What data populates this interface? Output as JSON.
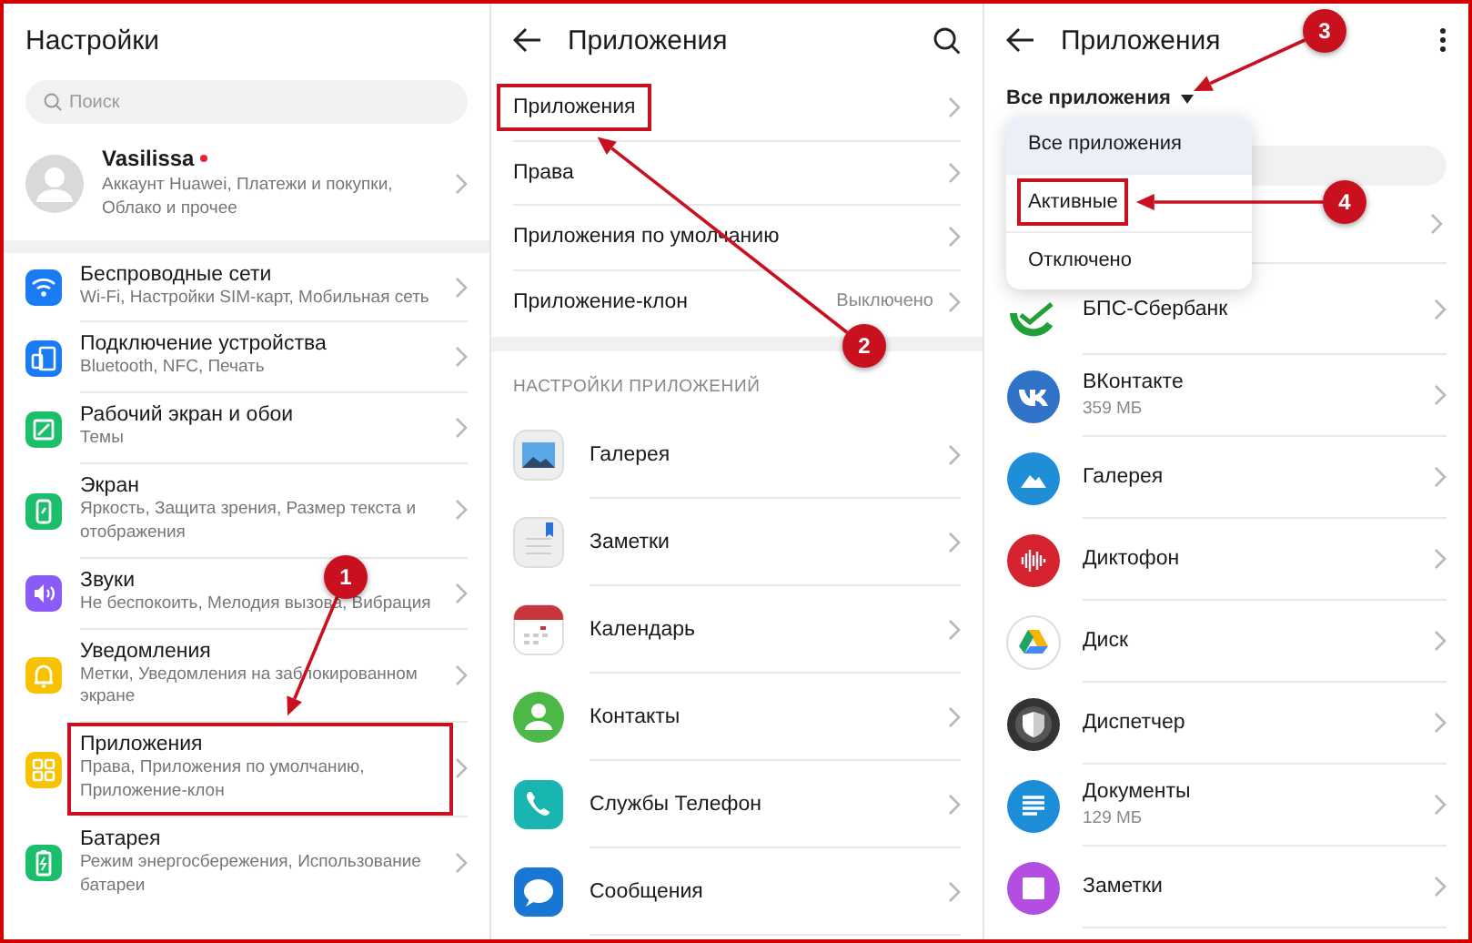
{
  "settings": {
    "title": "Настройки",
    "search": {
      "placeholder": "Поиск"
    },
    "profile": {
      "name": "Vasilissa",
      "notification": true,
      "subtitle": "Аккаунт Huawei, Платежи и покупки, Облако и прочее"
    },
    "items": [
      {
        "title": "Беспроводные сети",
        "subtitle": "Wi-Fi, Настройки SIM-карт, Мобильная сеть"
      },
      {
        "title": "Подключение устройства",
        "subtitle": "Bluetooth, NFC, Печать"
      },
      {
        "title": "Рабочий экран и обои",
        "subtitle": "Темы"
      },
      {
        "title": "Экран",
        "subtitle": "Яркость, Защита зрения, Размер текста и отображения"
      },
      {
        "title": "Звуки",
        "subtitle": "Не беспокоить, Мелодия вызова, Вибрация"
      },
      {
        "title": "Уведомления",
        "subtitle": "Метки, Уведомления на заблокированном экране"
      },
      {
        "title": "Приложения",
        "subtitle": "Права, Приложения по умолчанию, Приложение-клон"
      },
      {
        "title": "Батарея",
        "subtitle": "Режим энергосбережения, Использование батареи"
      }
    ]
  },
  "apps_menu": {
    "title": "Приложения",
    "items": [
      {
        "label": "Приложения"
      },
      {
        "label": "Права"
      },
      {
        "label": "Приложения по умолчанию"
      },
      {
        "label": "Приложение-клон",
        "value": "Выключено"
      }
    ],
    "section_title": "НАСТРОЙКИ ПРИЛОЖЕНИЙ",
    "apps": [
      {
        "name": "Галерея"
      },
      {
        "name": "Заметки"
      },
      {
        "name": "Календарь"
      },
      {
        "name": "Контакты"
      },
      {
        "name": "Службы Телефон"
      },
      {
        "name": "Сообщения"
      }
    ]
  },
  "app_list": {
    "title": "Приложения",
    "filter": "Все приложения",
    "dropdown": [
      {
        "label": "Все приложения",
        "selected": true
      },
      {
        "label": "Активные",
        "selected": false
      },
      {
        "label": "Отключено",
        "selected": false
      }
    ],
    "apps": [
      {
        "name": "БПС-Сбербанк"
      },
      {
        "name": "ВКонтакте",
        "size": "359 МБ"
      },
      {
        "name": "Галерея"
      },
      {
        "name": "Диктофон"
      },
      {
        "name": "Диск"
      },
      {
        "name": "Диспетчер"
      },
      {
        "name": "Документы",
        "size": "129 МБ"
      },
      {
        "name": "Заметки"
      }
    ]
  },
  "annotations": [
    {
      "number": "1"
    },
    {
      "number": "2"
    },
    {
      "number": "3"
    },
    {
      "number": "4"
    }
  ]
}
